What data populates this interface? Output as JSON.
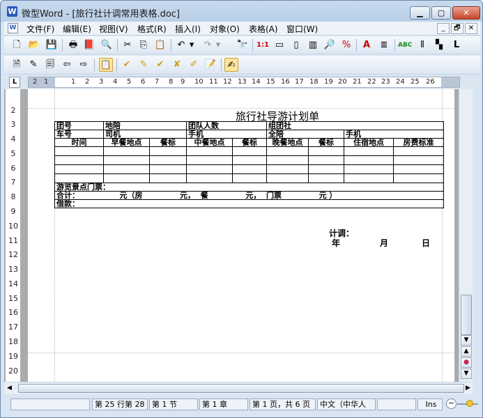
{
  "window": {
    "title": "微型Word - [旅行社计调常用表格.doc]",
    "app_icon": "W"
  },
  "window_controls": {
    "minimize": "▁",
    "maximize": "▢",
    "close": "✕"
  },
  "menubar": {
    "items": [
      "文件(F)",
      "编辑(E)",
      "视图(V)",
      "格式(R)",
      "插入(I)",
      "对象(O)",
      "表格(A)",
      "窗口(W)"
    ],
    "mdi": [
      "_",
      "🗗",
      "✕"
    ]
  },
  "ruler": {
    "corner": "L",
    "numbers": [
      "2",
      "1",
      "1",
      "2",
      "3",
      "4",
      "5",
      "6",
      "7",
      "8",
      "9",
      "10",
      "11",
      "12",
      "13",
      "14",
      "15",
      "16",
      "17",
      "18",
      "19",
      "20",
      "21",
      "22",
      "23",
      "24",
      "25",
      "26"
    ],
    "vertical": [
      "2",
      "3",
      "4",
      "5",
      "6",
      "7",
      "8",
      "9",
      "10",
      "11",
      "12",
      "13",
      "14",
      "15",
      "16",
      "17",
      "18",
      "19",
      "20"
    ]
  },
  "document": {
    "title": "旅行社导游计划单",
    "rows": {
      "r1": [
        "团号",
        "地陪",
        "团队人数",
        "组团社"
      ],
      "r2": [
        "车号",
        "司机",
        "手机",
        "全陪",
        "手机"
      ],
      "header": [
        "时间",
        "早餐地点",
        "餐标",
        "中餐地点",
        "餐标",
        "晚餐地点",
        "餐标",
        "住宿地点",
        "房费标准"
      ],
      "attractions": "游览景点门票：",
      "total": "合计：               元（房              元，  餐              元，  门票              元 ）",
      "loan": "借款："
    },
    "planner_label": "计调：",
    "date": {
      "year": "年",
      "month": "月",
      "day": "日"
    }
  },
  "statusbar": {
    "cells": [
      "",
      "第 25 行第 28",
      "第 1 节",
      "第 1 章",
      "第 1 页，共 6 页",
      "中文（中华人",
      "",
      "Ins"
    ]
  }
}
